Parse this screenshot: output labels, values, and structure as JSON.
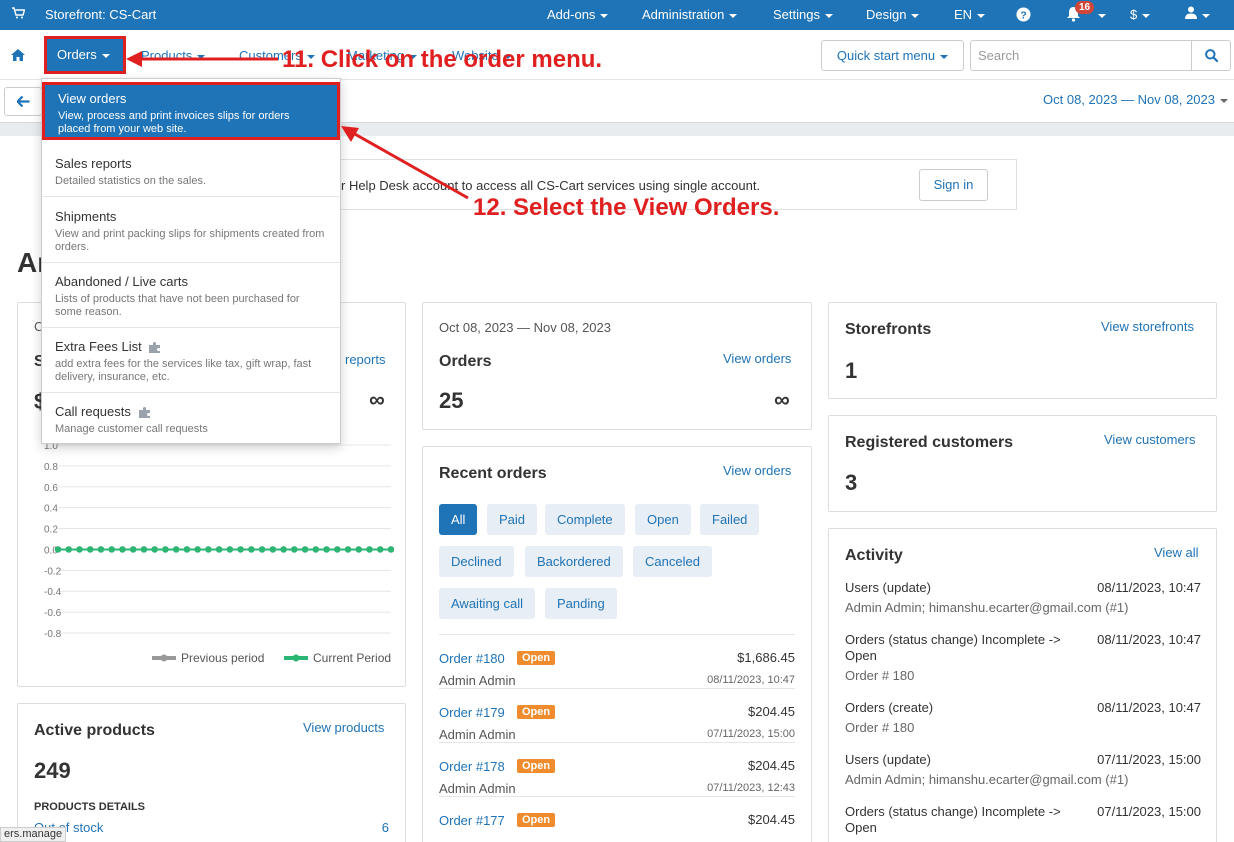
{
  "topbar": {
    "store_label": "Storefront: CS-Cart",
    "addons": "Add-ons",
    "administration": "Administration",
    "settings": "Settings",
    "design": "Design",
    "language": "EN",
    "notifications_count": "16",
    "currency": "$"
  },
  "nav": {
    "orders": "Orders",
    "products": "Products",
    "customers": "Customers",
    "marketing": "Marketing",
    "website": "Website",
    "quick_start": "Quick start menu",
    "search_placeholder": "Search"
  },
  "subbar": {
    "date_range": "Oct 08, 2023 — Nov 08, 2023"
  },
  "notice": {
    "text": "r Help Desk account to access all CS-Cart services using single account.",
    "signin": "Sign in"
  },
  "page_title": "An",
  "dropdown": [
    {
      "title": "View orders",
      "desc": "View, process and print invoices slips for orders placed from your web site."
    },
    {
      "title": "Sales reports",
      "desc": "Detailed statistics on the sales."
    },
    {
      "title": "Shipments",
      "desc": "View and print packing slips for shipments created from orders."
    },
    {
      "title": "Abandoned / Live carts",
      "desc": "Lists of products that have not been purchased for some reason."
    },
    {
      "title": "Extra Fees List",
      "desc": "add extra fees for the services like tax, gift wrap, fast delivery, insurance, etc."
    },
    {
      "title": "Call requests",
      "desc": "Manage customer call requests"
    }
  ],
  "sales_card": {
    "prefix_c": "C",
    "prefix_s": "S",
    "prefix_dollar": "$",
    "link": "reports",
    "infinity": "∞",
    "legend_prev": "Previous period",
    "legend_curr": "Current Period"
  },
  "chart_data": {
    "type": "line",
    "ylim": [
      -0.8,
      1.0
    ],
    "y_ticks": [
      "1.0",
      "0.8",
      "0.6",
      "0.4",
      "0.2",
      "0.0",
      "-0.2",
      "-0.4",
      "-0.6",
      "-0.8"
    ],
    "series": [
      {
        "name": "Previous period",
        "values": [
          0,
          0,
          0,
          0,
          0,
          0,
          0,
          0,
          0,
          0,
          0,
          0,
          0,
          0,
          0,
          0,
          0,
          0,
          0,
          0,
          0,
          0,
          0,
          0,
          0,
          0,
          0,
          0,
          0,
          0,
          0,
          0
        ],
        "color": "#999999"
      },
      {
        "name": "Current Period",
        "values": [
          0,
          0,
          0,
          0,
          0,
          0,
          0,
          0,
          0,
          0,
          0,
          0,
          0,
          0,
          0,
          0,
          0,
          0,
          0,
          0,
          0,
          0,
          0,
          0,
          0,
          0,
          0,
          0,
          0,
          0,
          0,
          0
        ],
        "color": "#2bb673"
      }
    ]
  },
  "active_products": {
    "title": "Active products",
    "link": "View products",
    "count": "249",
    "details_label": "PRODUCTS DETAILS",
    "out_of_stock": "Out of stock",
    "out_of_stock_count": "6"
  },
  "orders_card": {
    "date_range": "Oct 08, 2023 — Nov 08, 2023",
    "title": "Orders",
    "link": "View orders",
    "count": "25",
    "infinity": "∞"
  },
  "recent_orders": {
    "title": "Recent orders",
    "link": "View orders",
    "filters": [
      "All",
      "Paid",
      "Complete",
      "Open",
      "Failed",
      "Declined",
      "Backordered",
      "Canceled",
      "Awaiting call",
      "Panding"
    ],
    "orders": [
      {
        "id": "Order #180",
        "status": "Open",
        "customer": "Admin Admin",
        "amount": "$1,686.45",
        "date": "08/11/2023, 10:47"
      },
      {
        "id": "Order #179",
        "status": "Open",
        "customer": "Admin Admin",
        "amount": "$204.45",
        "date": "07/11/2023, 15:00"
      },
      {
        "id": "Order #178",
        "status": "Open",
        "customer": "Admin Admin",
        "amount": "$204.45",
        "date": "07/11/2023, 12:43"
      },
      {
        "id": "Order #177",
        "status": "Open",
        "customer": "Admin Admin",
        "amount": "$204.45",
        "date": ""
      }
    ]
  },
  "storefronts": {
    "title": "Storefronts",
    "link": "View storefronts",
    "count": "1"
  },
  "customers": {
    "title": "Registered customers",
    "link": "View customers",
    "count": "3"
  },
  "activity": {
    "title": "Activity",
    "link": "View all",
    "items": [
      {
        "title": "Users (update)",
        "date": "08/11/2023, 10:47",
        "sub": "Admin Admin; himanshu.ecarter@gmail.com (#1)"
      },
      {
        "title": "Orders (status change) Incomplete -> Open",
        "date": "08/11/2023, 10:47",
        "sub": "Order # 180"
      },
      {
        "title": "Orders (create)",
        "date": "08/11/2023, 10:47",
        "sub": "Order # 180"
      },
      {
        "title": "Users (update)",
        "date": "07/11/2023, 15:00",
        "sub": "Admin Admin; himanshu.ecarter@gmail.com (#1)"
      },
      {
        "title": "Orders (status change) Incomplete -> Open",
        "date": "07/11/2023, 15:00",
        "sub": ""
      }
    ]
  },
  "annotations": {
    "step11": "11. Click on the order menu.",
    "step12": "12. Select the View Orders."
  },
  "status_tip": "ers.manage",
  "colors": {
    "primary": "#1f73b7",
    "annotation": "#e02020",
    "open_badge": "#f08c2e",
    "series_current": "#2bb673"
  }
}
